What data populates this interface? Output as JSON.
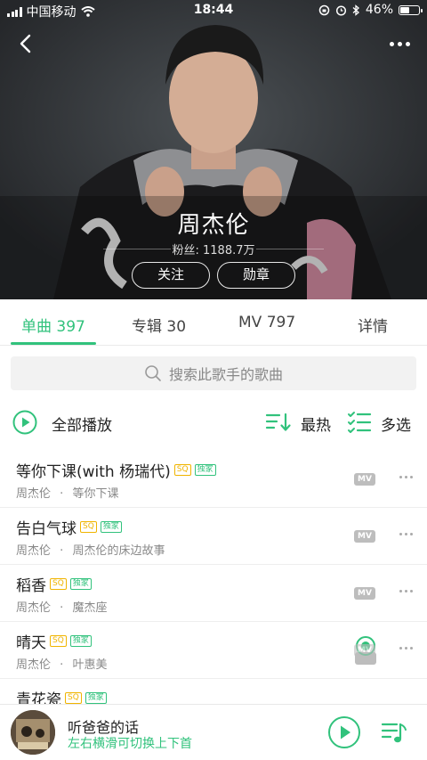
{
  "status_bar": {
    "carrier": "中国移动",
    "time": "18:44",
    "battery": "46%"
  },
  "artist": {
    "name": "周杰伦",
    "fans": "粉丝: 1188.7万",
    "follow_label": "关注",
    "medal_label": "勋章"
  },
  "tabs": [
    {
      "label": "单曲 397",
      "active": true
    },
    {
      "label": "专辑 30",
      "active": false
    },
    {
      "label": "MV 797",
      "active": false
    },
    {
      "label": "详情",
      "active": false
    }
  ],
  "search": {
    "placeholder": "搜索此歌手的歌曲"
  },
  "actions": {
    "play_all": "全部播放",
    "hot": "最热",
    "multi_select": "多选"
  },
  "songs": [
    {
      "title": "等你下课(with 杨瑞代)",
      "tags": [
        "SQ",
        "独家"
      ],
      "artist": "周杰伦",
      "album": "等你下课",
      "mv": "MV",
      "playing": false
    },
    {
      "title": "告白气球",
      "tags": [
        "SQ",
        "独家"
      ],
      "artist": "周杰伦",
      "album": "周杰伦的床边故事",
      "mv": "MV",
      "playing": false
    },
    {
      "title": "稻香",
      "tags": [
        "SQ",
        "独家"
      ],
      "artist": "周杰伦",
      "album": "魔杰座",
      "mv": "MV",
      "playing": false
    },
    {
      "title": "晴天",
      "tags": [
        "SQ",
        "独家"
      ],
      "artist": "周杰伦",
      "album": "叶惠美",
      "mv": "MV",
      "playing": true
    },
    {
      "title": "青花瓷",
      "tags": [
        "SQ",
        "独家"
      ],
      "artist": "",
      "album": "",
      "mv": "",
      "playing": false
    }
  ],
  "player": {
    "title": "听爸爸的话",
    "subtitle": "左右横滑可切换上下首"
  },
  "colors": {
    "accent": "#31c27c",
    "sq_tag": "#f0b400"
  },
  "separator": "·",
  "icons": {
    "back": "chevron-left-icon",
    "more": "more-dots-icon",
    "search": "search-icon",
    "play_all": "play-circle-icon",
    "hot": "sort-icon",
    "multi": "list-check-icon",
    "playlist": "playlist-icon"
  }
}
